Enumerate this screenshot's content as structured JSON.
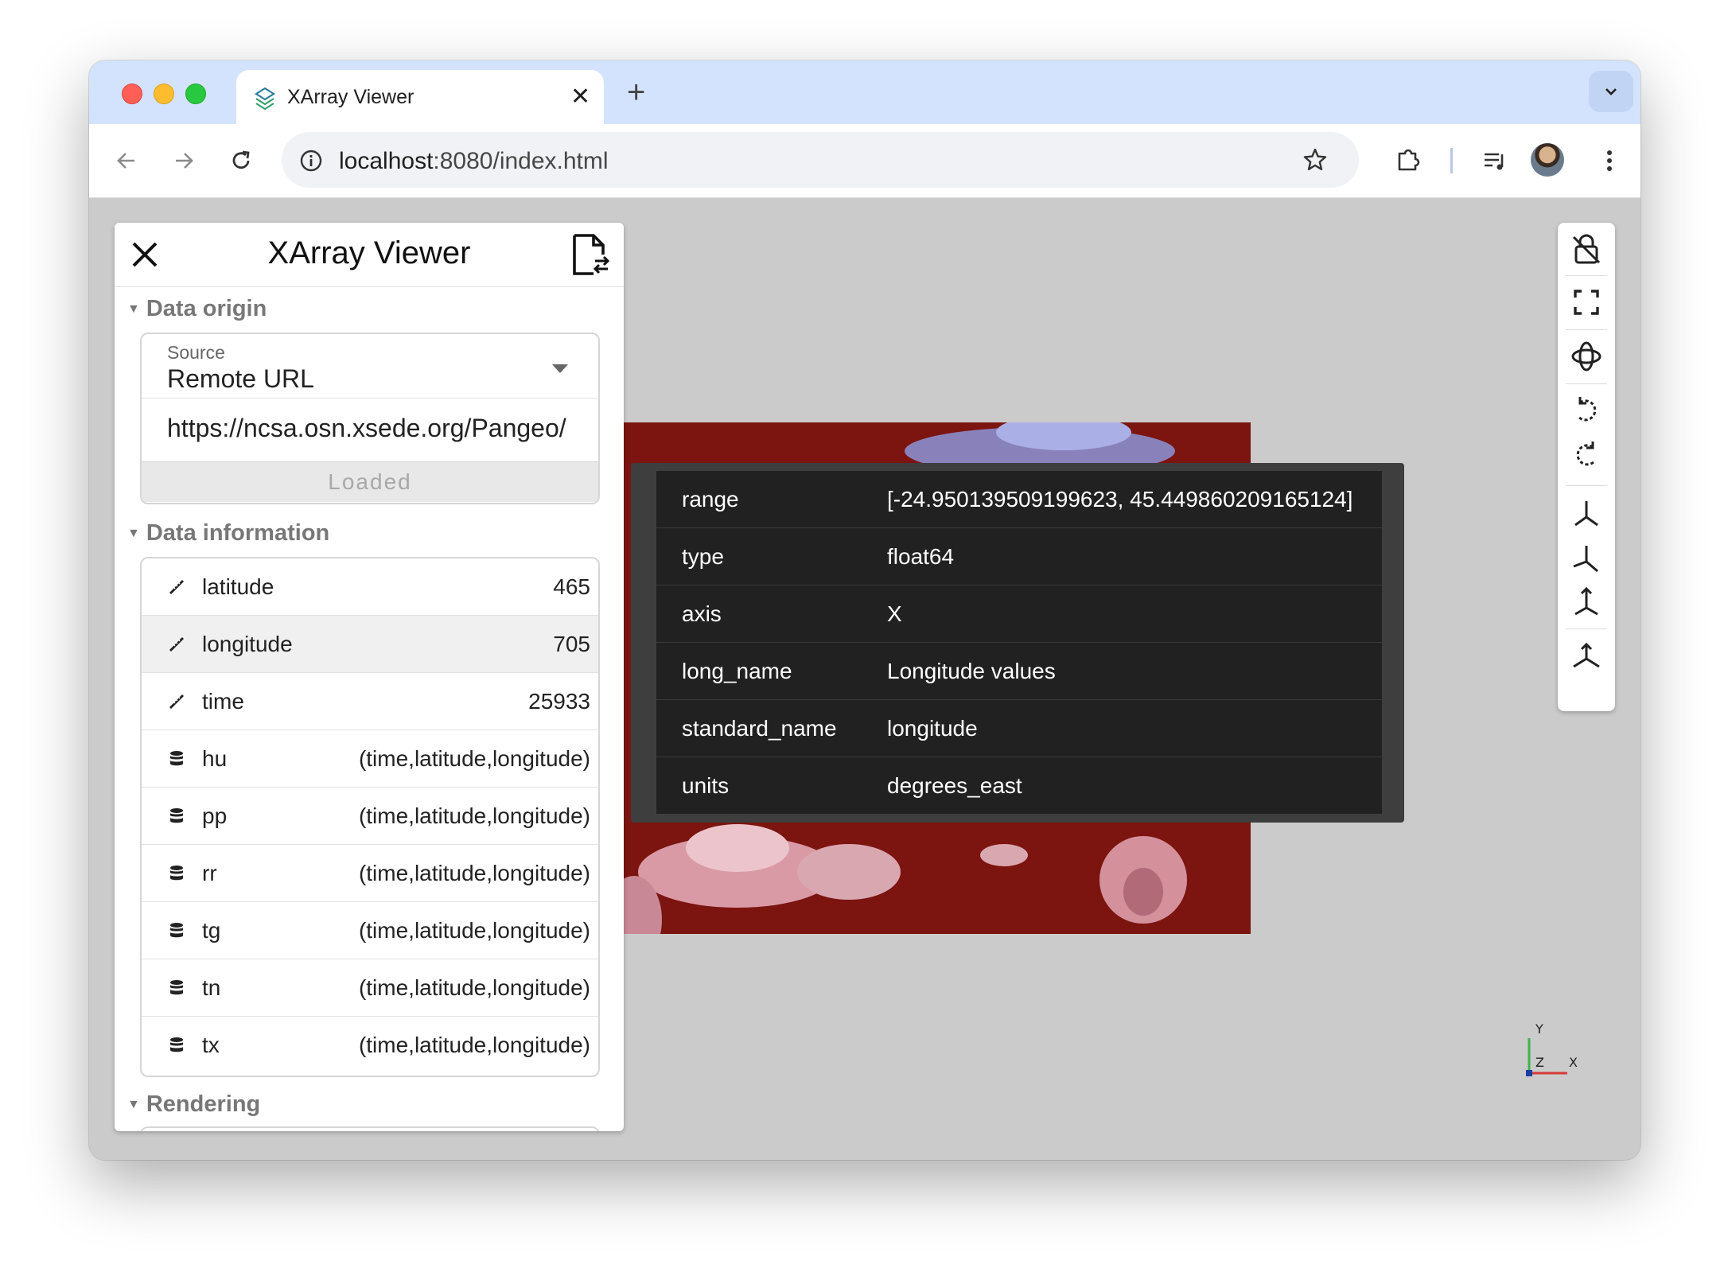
{
  "browser": {
    "tab_title": "XArray Viewer",
    "tab_close": "✕",
    "new_tab": "+",
    "url_host": "localhost",
    "url_rest": ":8080/index.html"
  },
  "panel": {
    "title": "XArray Viewer",
    "sections": {
      "origin": "Data origin",
      "info": "Data information",
      "rendering": "Rendering"
    },
    "source": {
      "label": "Source",
      "value": "Remote URL",
      "url": "https://ncsa.osn.xsede.org/Pangeo/",
      "status": "Loaded"
    },
    "data_rows": [
      {
        "name": "latitude",
        "value": "465",
        "icon": "ruler-icon"
      },
      {
        "name": "longitude",
        "value": "705",
        "icon": "ruler-icon"
      },
      {
        "name": "time",
        "value": "25933",
        "icon": "ruler-icon"
      },
      {
        "name": "hu",
        "value": "(time,latitude,longitude)",
        "icon": "database-icon"
      },
      {
        "name": "pp",
        "value": "(time,latitude,longitude)",
        "icon": "database-icon"
      },
      {
        "name": "rr",
        "value": "(time,latitude,longitude)",
        "icon": "database-icon"
      },
      {
        "name": "tg",
        "value": "(time,latitude,longitude)",
        "icon": "database-icon"
      },
      {
        "name": "tn",
        "value": "(time,latitude,longitude)",
        "icon": "database-icon"
      },
      {
        "name": "tx",
        "value": "(time,latitude,longitude)",
        "icon": "database-icon"
      }
    ]
  },
  "tooltip": {
    "rows": [
      {
        "key": "range",
        "value": "[-24.950139509199623, 45.449860209165124]"
      },
      {
        "key": "type",
        "value": "float64"
      },
      {
        "key": "axis",
        "value": "X"
      },
      {
        "key": "long_name",
        "value": "Longitude values"
      },
      {
        "key": "standard_name",
        "value": "longitude"
      },
      {
        "key": "units",
        "value": "degrees_east"
      }
    ]
  },
  "axes_widget": {
    "x": "X",
    "y": "Y",
    "z": "Z"
  },
  "colors": {
    "tab_strip": "#d3e3fd",
    "viewport_bg": "#cbcbcb",
    "heatmap_bg": "#7c1410",
    "tooltip_bg": "#212121"
  }
}
